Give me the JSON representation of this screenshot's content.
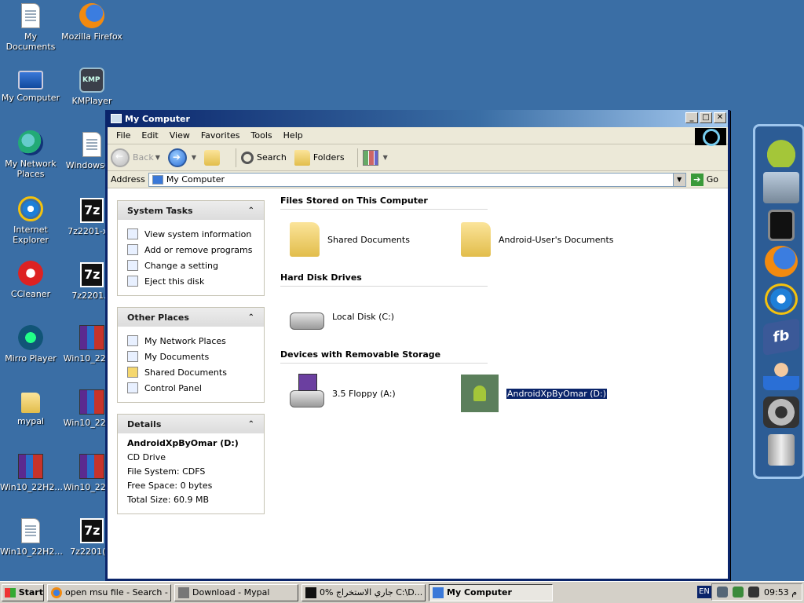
{
  "desktop": {
    "icons": [
      {
        "label": "My Documents",
        "icon": "my-documents-icon"
      },
      {
        "label": "Mozilla Firefox",
        "icon": "firefox-icon"
      },
      {
        "label": "My Computer",
        "icon": "my-computer-icon"
      },
      {
        "label": "KMPlayer",
        "icon": "kmplayer-icon"
      },
      {
        "label": "My Network Places",
        "icon": "network-places-icon"
      },
      {
        "label": "Windows6...",
        "icon": "document-icon"
      },
      {
        "label": "Internet Explorer",
        "icon": "internet-explorer-icon"
      },
      {
        "label": "7z2201-x...",
        "icon": "7zip-icon"
      },
      {
        "label": "CCleaner",
        "icon": "ccleaner-icon"
      },
      {
        "label": "7z2201...",
        "icon": "7zip-icon"
      },
      {
        "label": "Mirro Player",
        "icon": "mirro-player-icon"
      },
      {
        "label": "Win10_22H...",
        "icon": "winrar-icon"
      },
      {
        "label": "mypal",
        "icon": "folder-icon"
      },
      {
        "label": "Win10_22H...",
        "icon": "winrar-icon"
      },
      {
        "label": "Win10_22H2...",
        "icon": "winrar-icon"
      },
      {
        "label": "Win10_22H...",
        "icon": "winrar-icon"
      },
      {
        "label": "Win10_22H2...",
        "icon": "document-icon"
      },
      {
        "label": "7z2201(...",
        "icon": "7zip-icon"
      }
    ]
  },
  "window": {
    "title": "My Computer",
    "minimize": "_",
    "maximize": "□",
    "close": "✕",
    "menu": [
      "File",
      "Edit",
      "View",
      "Favorites",
      "Tools",
      "Help"
    ],
    "toolbar": {
      "back": "Back",
      "search": "Search",
      "folders": "Folders"
    },
    "address": {
      "label": "Address",
      "value": "My Computer",
      "go": "Go"
    },
    "left": {
      "system_tasks": {
        "title": "System Tasks",
        "items": [
          "View system information",
          "Add or remove programs",
          "Change a setting",
          "Eject this disk"
        ]
      },
      "other_places": {
        "title": "Other Places",
        "items": [
          "My Network Places",
          "My Documents",
          "Shared Documents",
          "Control Panel"
        ]
      },
      "details": {
        "title": "Details",
        "name": "AndroidXpByOmar (D:)",
        "type": "CD Drive",
        "filesystem": "File System: CDFS",
        "free": "Free Space: 0 bytes",
        "total": "Total Size: 60.9 MB"
      }
    },
    "groups": {
      "files_stored": {
        "title": "Files Stored on This Computer",
        "items": [
          "Shared Documents",
          "Android-User's Documents"
        ]
      },
      "hard_disks": {
        "title": "Hard Disk Drives",
        "items": [
          "Local Disk (C:)"
        ]
      },
      "removable": {
        "title": "Devices with Removable Storage",
        "items": [
          "3.5 Floppy (A:)",
          "AndroidXpByOmar (D:)"
        ]
      }
    }
  },
  "taskbar": {
    "start": "Start",
    "tasks": [
      {
        "label": "open msu file - Search - ...",
        "icon": "firefox-icon"
      },
      {
        "label": "Download - Mypal",
        "icon": "mypal-icon"
      },
      {
        "label": "0% جاري الاستخراج C:\\D...",
        "icon": "7zip-icon"
      },
      {
        "label": "My Computer",
        "icon": "my-computer-icon"
      }
    ],
    "lang": "EN",
    "clock": "09:53 م"
  }
}
